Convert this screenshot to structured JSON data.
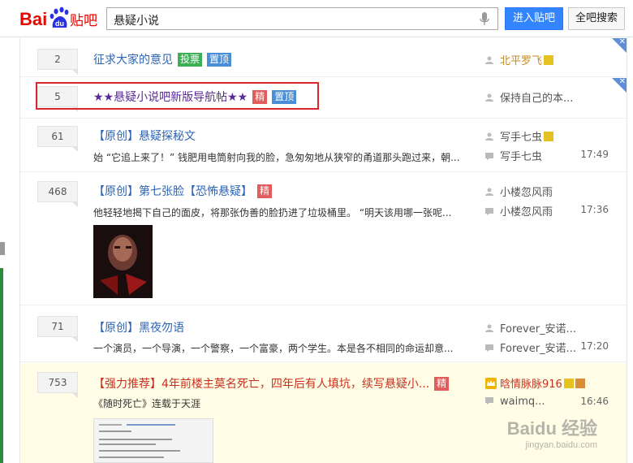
{
  "header": {
    "logo_text": "Bai",
    "logo_du": "du",
    "logo_suffix": "贴吧",
    "search_value": "悬疑小说",
    "enter_button": "进入贴吧",
    "search_all_button": "全吧搜索"
  },
  "threads": [
    {
      "replies": "2",
      "title": "征求大家的意见",
      "tags": [
        "投票",
        "置顶"
      ],
      "author": "北平罗飞",
      "time": ""
    },
    {
      "replies": "5",
      "title": "★★悬疑小说吧新版导航帖★★",
      "tags": [
        "精",
        "置顶"
      ],
      "author": "保持自己的本...",
      "time": ""
    },
    {
      "replies": "61",
      "title": "【原创】悬疑探秘文",
      "excerpt": "始 “它追上来了！” 钱肥用电筒射向我的脸，急匆匆地从狭窄的甬道那头跑过来，朝...",
      "author": "写手七虫",
      "last_replier": "写手七虫",
      "time": "17:49"
    },
    {
      "replies": "468",
      "title": "【原创】第七张脸【恐怖悬疑】",
      "tags": [
        "精"
      ],
      "excerpt": "他轻轻地揭下自己的面皮，将那张伪善的脸扔进了垃圾桶里。 “明天该用哪一张呢...",
      "author": "小楼忽风雨",
      "last_replier": "小楼忽风雨",
      "time": "17:36"
    },
    {
      "replies": "71",
      "title": "【原创】黑夜勿语",
      "excerpt": "一个演员，一个导演，一个警察，一个富豪，两个学生。本是各不相同的命运却意...",
      "author": "Forever_安诺...",
      "last_replier": "Forever_安诺...",
      "time": "17:20"
    },
    {
      "replies": "753",
      "title": "【强力推荐】4年前楼主莫名死亡，四年后有人填坑，续写悬疑小...",
      "tags": [
        "精"
      ],
      "excerpt": "《随时死亡》连载于天涯",
      "author": "晗情脉脉916",
      "last_replier": "waimq...",
      "time": "16:46"
    }
  ],
  "close_mark": "✕",
  "watermark": {
    "line1": "Baidu 经验",
    "line2": "jingyan.baidu.com"
  },
  "colors": {
    "link_blue": "#2d64b3",
    "highlight_red": "#d9272d",
    "recommend_red": "#c9301e",
    "button_blue": "#3385ff",
    "recommend_bg": "#fffde6"
  }
}
